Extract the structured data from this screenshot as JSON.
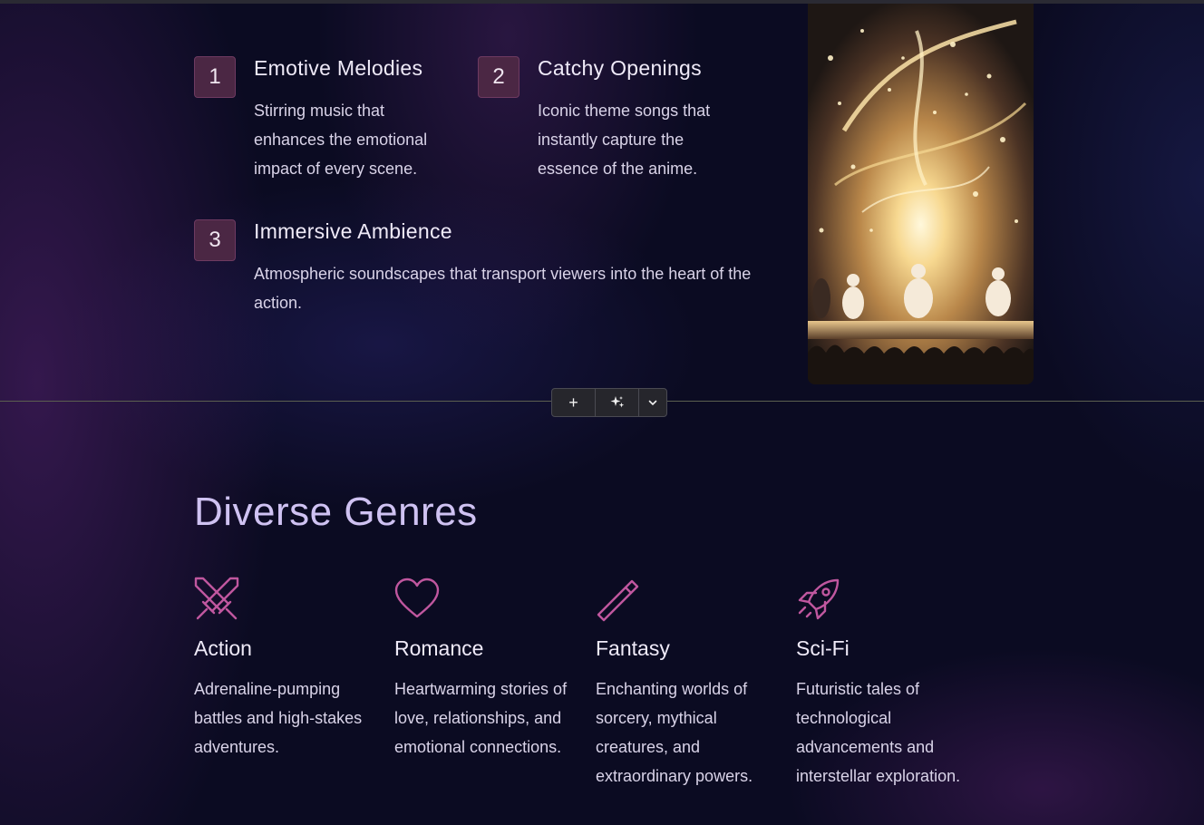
{
  "features": [
    {
      "number": "1",
      "title": "Emotive Melodies",
      "description": "Stirring music that enhances the emotional impact of every scene."
    },
    {
      "number": "2",
      "title": "Catchy Openings",
      "description": "Iconic theme songs that instantly capture the essence of the anime."
    },
    {
      "number": "3",
      "title": "Immersive Ambience",
      "description": "Atmospheric soundscapes that transport viewers into the heart of the action."
    }
  ],
  "image": {
    "alt": "Illustration of anime performers on a glowing concert stage"
  },
  "toolbar": {
    "add_label": "+",
    "ai_icon": "sparkles-icon",
    "menu_icon": "chevron-down-icon"
  },
  "genres_section": {
    "title": "Diverse Genres",
    "items": [
      {
        "icon": "crossed-swords-icon",
        "title": "Action",
        "description": "Adrenaline-pumping battles and high-stakes adventures."
      },
      {
        "icon": "heart-icon",
        "title": "Romance",
        "description": "Heartwarming stories of love, relationships, and emotional connections."
      },
      {
        "icon": "magic-wand-icon",
        "title": "Fantasy",
        "description": "Enchanting worlds of sorcery, mythical creatures, and extraordinary powers."
      },
      {
        "icon": "rocket-icon",
        "title": "Sci-Fi",
        "description": "Futuristic tales of technological advancements and interstellar exploration."
      }
    ]
  },
  "colors": {
    "background": "#0b0b22",
    "accent": "#c0579f",
    "badge": "#4b2744",
    "heading": "#cfc2f2"
  }
}
